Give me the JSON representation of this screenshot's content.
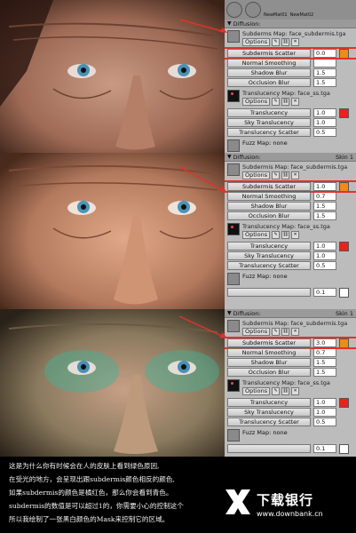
{
  "top_tabs": [
    "NewMat01",
    "NewMat02"
  ],
  "panels": [
    {
      "header_left": "Diffusion:",
      "header_right": "",
      "subdermis_map": "Subderms Map: face_subdermis.tga",
      "scatter_label": "Subdermis Scatter",
      "scatter_value": "0.0",
      "normal_smooth": "Normal Smoothing",
      "normal_smooth_value": "",
      "shadow_blur": "Shadow Blur",
      "shadow_blur_value": "1.5",
      "occlusion_blur": "Occlusion Blur",
      "occlusion_blur_value": "1.5",
      "translucency_map": "Translucency Map: face_ss.tga",
      "translucency": "Translucency",
      "translucency_value": "1.0",
      "sky_translucency": "Sky Translucency",
      "sky_translucency_value": "1.0",
      "translucency_scatter": "Translucency Scatter",
      "translucency_scatter_value": "0.5",
      "fuzz_map": "Fuzz Map: none"
    },
    {
      "header_left": "Diffusion:",
      "header_right": "Skin 1",
      "subdermis_map": "Subdermis Map: face_subdermis.tga",
      "scatter_label": "Subdermis Scatter",
      "scatter_value": "1.0",
      "normal_smooth": "Normal Smoothing",
      "normal_smooth_value": "0.7",
      "shadow_blur": "Shadow Blur",
      "shadow_blur_value": "1.5",
      "occlusion_blur": "Occlusion Blur",
      "occlusion_blur_value": "1.5",
      "translucency_map": "Translucency Map: face_ss.tga",
      "translucency": "Translucency",
      "translucency_value": "1.0",
      "sky_translucency": "Sky Translucency",
      "sky_translucency_value": "1.0",
      "translucency_scatter": "Translucency Scatter",
      "translucency_scatter_value": "0.5",
      "fuzz_map": "Fuzz Map: none",
      "fuzz_value": "0.1"
    },
    {
      "header_left": "Diffusion:",
      "header_right": "Skin 1",
      "subdermis_map": "Subdermis Map: face_subdermis.tga",
      "scatter_label": "Subdermis Scatter",
      "scatter_value": "3.0",
      "normal_smooth": "Normal Smoothing",
      "normal_smooth_value": "0.7",
      "shadow_blur": "Shadow Blur",
      "shadow_blur_value": "1.5",
      "occlusion_blur": "Occlusion Blur",
      "occlusion_blur_value": "1.5",
      "translucency_map": "Translucency Map: face_ss.tga",
      "translucency": "Translucency",
      "translucency_value": "1.0",
      "sky_translucency": "Sky Translucency",
      "sky_translucency_value": "1.0",
      "translucency_scatter": "Translucency Scatter",
      "translucency_scatter_value": "0.5",
      "fuzz_map": "Fuzz Map: none",
      "fuzz_value": "0.1"
    }
  ],
  "options_label": "Options",
  "caption": [
    "这是为什么你有时候会在人的皮肤上看到绿色原因,",
    "在受光的地方，会呈现出跟subdermis颜色相反的颜色,",
    "如果subdermis的颜色是橘红色，那么你会看到青色。",
    "subdermis的数值是可以超过1的，你需要小心的控制这个",
    "所以我绘制了一张黑白颜色的Mask来控制它的区域。"
  ],
  "watermark": {
    "title": "下载银行",
    "url": "www.downbank.cn"
  },
  "colors": {
    "scatter_swatch": "#f08a1a",
    "translucency_swatch": "#e8221c",
    "highlight": "#e0322b"
  }
}
